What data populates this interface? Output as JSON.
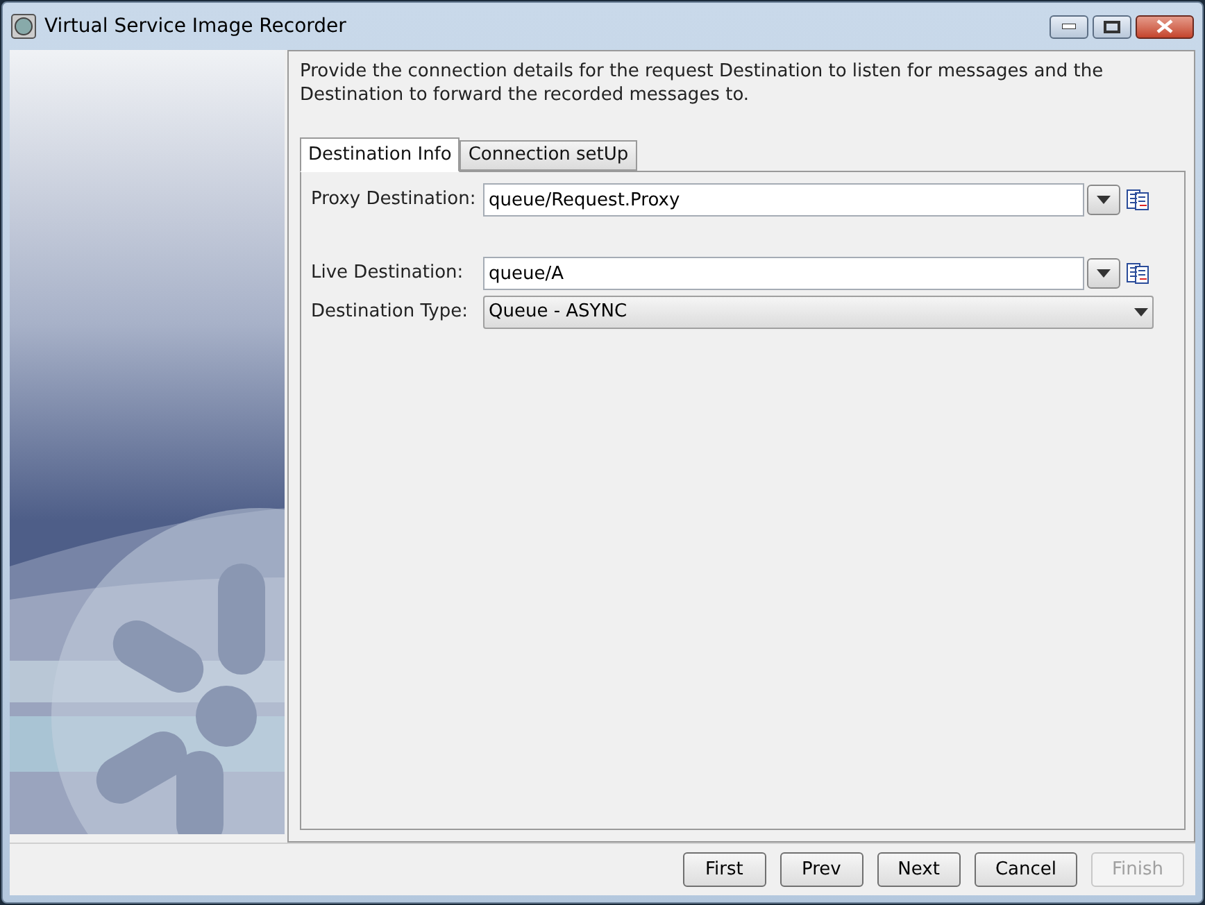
{
  "window": {
    "title": "Virtual Service Image Recorder"
  },
  "instructions": "Provide the connection details for the request Destination to listen for messages and the Destination to forward the recorded messages to.",
  "tabs": [
    {
      "label": "Destination Info",
      "selected": true
    },
    {
      "label": "Connection setUp",
      "selected": false
    }
  ],
  "fields": [
    {
      "kind": "text",
      "label": "Proxy Destination:",
      "value": "queue/Request.Proxy"
    },
    {
      "kind": "text",
      "label": "Live Destination:",
      "value": "queue/A"
    },
    {
      "kind": "select",
      "label": "Destination Type:",
      "value": "Queue - ASYNC"
    }
  ],
  "buttons": [
    {
      "label": "First",
      "disabled": false
    },
    {
      "label": "Prev",
      "disabled": false
    },
    {
      "label": "Next",
      "disabled": false
    },
    {
      "label": "Cancel",
      "disabled": false
    },
    {
      "label": "Finish",
      "disabled": true
    }
  ]
}
